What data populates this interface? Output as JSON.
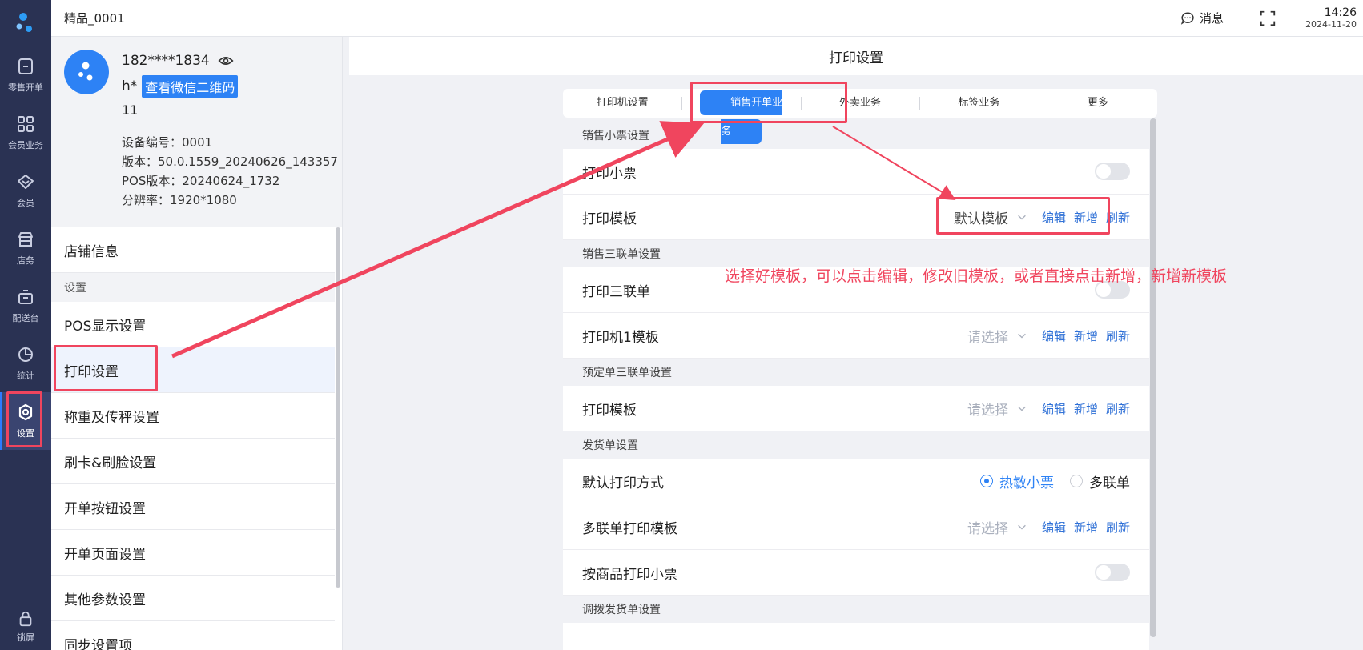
{
  "app": {
    "title": "精品_0001"
  },
  "topbar": {
    "message_label": "消息",
    "time": "14:26",
    "date": "2024-11-20"
  },
  "rail": {
    "items": [
      {
        "label": "零售开单",
        "icon": "receipt-icon"
      },
      {
        "label": "会员业务",
        "icon": "grid-icon"
      },
      {
        "label": "会员",
        "icon": "diamond-icon"
      },
      {
        "label": "店务",
        "icon": "store-icon"
      },
      {
        "label": "配送台",
        "icon": "delivery-icon"
      },
      {
        "label": "统计",
        "icon": "pie-chart-icon"
      },
      {
        "label": "设置",
        "icon": "gear-icon"
      }
    ],
    "lock_label": "锁屏"
  },
  "profile": {
    "phone": "182****1834",
    "name": "h*",
    "qr_button": "查看微信二维码",
    "number": "11",
    "device": "设备编号：0001",
    "version": "版本：50.0.1559_20240626_143357",
    "pos_version": "POS版本：20240624_1732",
    "resolution": "分辨率：1920*1080"
  },
  "menu": {
    "store_info": "店铺信息",
    "section": "设置",
    "items": [
      "POS显示设置",
      "打印设置",
      "称重及传秤设置",
      "刷卡&刷脸设置",
      "开单按钮设置",
      "开单页面设置",
      "其他参数设置",
      "同步设置项"
    ]
  },
  "content": {
    "title": "打印设置",
    "tabs": [
      "打印机设置",
      "销售开单业务",
      "外卖业务",
      "标签业务",
      "更多"
    ],
    "sections": {
      "s1": "销售小票设置",
      "s2": "销售三联单设置",
      "s3": "预定单三联单设置",
      "s4": "发货单设置",
      "s5": "调拨发货单设置"
    },
    "rows": {
      "print_receipt": "打印小票",
      "print_template": "打印模板",
      "print_triple": "打印三联单",
      "printer1_template": "打印机1模板",
      "preorder_template": "打印模板",
      "default_mode": "默认打印方式",
      "multi_template": "多联单打印模板",
      "print_by_goods": "按商品打印小票"
    },
    "default_template": "默认模板",
    "placeholder": "请选择",
    "edit": "编辑",
    "add": "新增",
    "refresh": "刷新",
    "radio_thermal": "热敏小票",
    "radio_multi": "多联单"
  },
  "annotation": {
    "text": "选择好模板，可以点击编辑，修改旧模板，或者直接点击新增，新增新模板",
    "color": "#f0455e"
  }
}
